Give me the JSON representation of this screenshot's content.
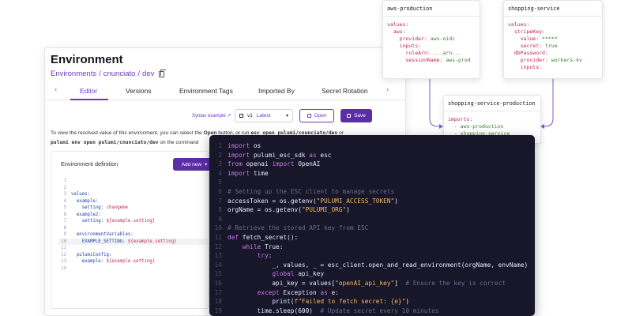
{
  "environment": {
    "title": "Environment",
    "breadcrumb": [
      "Environments",
      "cnunciato",
      "dev"
    ],
    "tabs": [
      "Editor",
      "Versions",
      "Environment Tags",
      "Imported By",
      "Secret Rotation"
    ],
    "active_tab": "Editor",
    "toolbar": {
      "syntax_label": "Syntax example ↗",
      "version_label": "v1",
      "version_tag": "Latest",
      "open_label": "Open",
      "save_label": "Save"
    },
    "description": {
      "part1": "To view the resolved value of this environment, you can select the",
      "open_word": "Open",
      "part2": "button, or run",
      "cmd1": "esc open pulumi/cnunciato/dev",
      "or": "or",
      "cmd2": "pulumi env open pulumi/cnunciato/dev",
      "part3": "on the command"
    },
    "definition": {
      "title": "Environment definition",
      "add_new_label": "Add new",
      "lines": [
        {
          "n": "1",
          "text": ""
        },
        {
          "n": "2",
          "text": ""
        },
        {
          "n": "3",
          "key": "values:"
        },
        {
          "n": "4",
          "key": "  example:"
        },
        {
          "n": "5",
          "key": "    setting:",
          "val": " changeme"
        },
        {
          "n": "6",
          "key": "  example2:"
        },
        {
          "n": "7",
          "key": "    setting:",
          "val": " ${example.setting}"
        },
        {
          "n": "8",
          "text": ""
        },
        {
          "n": "9",
          "key": "  environmentVariables:"
        },
        {
          "n": "10",
          "key": "    EXAMPLE_SETTING:",
          "val": " ${example.setting}"
        },
        {
          "n": "11",
          "text": ""
        },
        {
          "n": "12",
          "key": "  pulumiConfig:"
        },
        {
          "n": "13",
          "key": "    example:",
          "val": " ${example.setting}"
        },
        {
          "n": "14",
          "text": ""
        }
      ]
    }
  },
  "code": {
    "lines": [
      {
        "n": "1",
        "segs": [
          [
            "kw",
            "import "
          ],
          [
            "nm",
            "os"
          ]
        ]
      },
      {
        "n": "2",
        "segs": [
          [
            "kw",
            "import "
          ],
          [
            "nm",
            "pulumi_esc_sdk "
          ],
          [
            "kw",
            "as "
          ],
          [
            "nm",
            "esc"
          ]
        ]
      },
      {
        "n": "3",
        "segs": [
          [
            "kw",
            "from "
          ],
          [
            "nm",
            "openai "
          ],
          [
            "kw",
            "import "
          ],
          [
            "nm",
            "OpenAI"
          ]
        ]
      },
      {
        "n": "4",
        "segs": [
          [
            "kw",
            "import "
          ],
          [
            "nm",
            "time"
          ]
        ]
      },
      {
        "n": "5",
        "segs": []
      },
      {
        "n": "6",
        "segs": [
          [
            "cm",
            "# Setting up the ESC client to manage secrets"
          ]
        ]
      },
      {
        "n": "7",
        "segs": [
          [
            "nm",
            "accessToken = os.getenv("
          ],
          [
            "str",
            "\"PULUMI_ACCESS_TOKEN\""
          ],
          [
            "nm",
            ")"
          ]
        ]
      },
      {
        "n": "8",
        "segs": [
          [
            "nm",
            "orgName = os.getenv("
          ],
          [
            "str",
            "\"PULUMI_ORG\""
          ],
          [
            "nm",
            ")"
          ]
        ]
      },
      {
        "n": "9",
        "segs": []
      },
      {
        "n": "10",
        "segs": [
          [
            "cm",
            "# Retrieve the stored API key from ESC"
          ]
        ]
      },
      {
        "n": "11",
        "segs": [
          [
            "kw",
            "def "
          ],
          [
            "fn",
            "fetch_secret"
          ],
          [
            "nm",
            "():"
          ]
        ]
      },
      {
        "n": "12",
        "segs": [
          [
            "nm",
            "    "
          ],
          [
            "kw",
            "while "
          ],
          [
            "nm",
            "True:"
          ]
        ]
      },
      {
        "n": "13",
        "segs": [
          [
            "nm",
            "        "
          ],
          [
            "kw",
            "try"
          ],
          [
            "nm",
            ":"
          ]
        ]
      },
      {
        "n": "14",
        "segs": [
          [
            "nm",
            "            _, values, _ = esc_client.open_and_read_environment(orgName, envName)"
          ]
        ]
      },
      {
        "n": "15",
        "segs": [
          [
            "nm",
            "            "
          ],
          [
            "kw",
            "global "
          ],
          [
            "nm",
            "api_key"
          ]
        ]
      },
      {
        "n": "16",
        "segs": [
          [
            "nm",
            "            api_key = values["
          ],
          [
            "str",
            "\"openAI_api_key\""
          ],
          [
            "nm",
            "]  "
          ],
          [
            "cm",
            "# Ensure the key is correct"
          ]
        ]
      },
      {
        "n": "17",
        "segs": [
          [
            "nm",
            "        "
          ],
          [
            "kw",
            "except "
          ],
          [
            "nm",
            "Exception "
          ],
          [
            "kw",
            "as "
          ],
          [
            "nm",
            "e:"
          ]
        ]
      },
      {
        "n": "18",
        "segs": [
          [
            "nm",
            "            print("
          ],
          [
            "str",
            "f\"Failed to fetch secret: {e}\""
          ],
          [
            "nm",
            ")"
          ]
        ]
      },
      {
        "n": "19",
        "segs": [
          [
            "nm",
            "        time.sleep(600)  "
          ],
          [
            "cm",
            "# Update secret every 10 minutes"
          ]
        ]
      }
    ]
  },
  "cards": {
    "aws_production": {
      "title": "aws-production",
      "lines": [
        {
          "segs": [
            [
              "r",
              "values:"
            ]
          ]
        },
        {
          "segs": [
            [
              "r",
              "  aws:"
            ]
          ]
        },
        {
          "segs": [
            [
              "r",
              "    provider: "
            ],
            [
              "g",
              "aws-oidc"
            ]
          ]
        },
        {
          "segs": [
            [
              "r",
              "    inputs:"
            ]
          ]
        },
        {
          "segs": [
            [
              "r",
              "      roleArn: "
            ],
            [
              "g",
              "...arn..."
            ]
          ]
        },
        {
          "segs": [
            [
              "r",
              "      sessionName: "
            ],
            [
              "g",
              "aws-prod"
            ]
          ]
        }
      ]
    },
    "shopping_service": {
      "title": "shopping-service",
      "lines": [
        {
          "segs": [
            [
              "r",
              "values:"
            ]
          ]
        },
        {
          "segs": [
            [
              "r",
              "  stripeKey:"
            ]
          ]
        },
        {
          "segs": [
            [
              "r",
              "    value: "
            ],
            [
              "g",
              "*****"
            ]
          ]
        },
        {
          "segs": [
            [
              "r",
              "    secret: "
            ],
            [
              "g",
              "true"
            ]
          ]
        },
        {
          "segs": [
            [
              "r",
              "  dbPassword:"
            ]
          ]
        },
        {
          "segs": [
            [
              "r",
              "    provider: "
            ],
            [
              "g",
              "workers-kv"
            ]
          ]
        },
        {
          "segs": [
            [
              "r",
              "    inputs:"
            ]
          ]
        }
      ]
    },
    "shopping_service_production": {
      "title": "shopping-service-production",
      "lines": [
        {
          "segs": [
            [
              "r",
              "imports:"
            ]
          ]
        },
        {
          "segs": [
            [
              "r",
              "  - "
            ],
            [
              "g",
              "aws-production"
            ]
          ]
        },
        {
          "segs": [
            [
              "r",
              "  - "
            ],
            [
              "g",
              "shopping-service"
            ]
          ]
        }
      ]
    }
  },
  "colors": {
    "accent": "#5b2da6",
    "connector": "#7b5cc9",
    "code_bg": "#181629"
  }
}
